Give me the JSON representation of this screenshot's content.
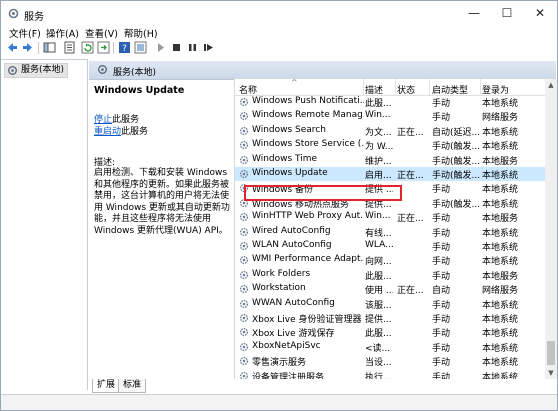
{
  "window": {
    "title": "服务",
    "minimize": "—",
    "maximize": "☐",
    "close": "✕"
  },
  "menu": [
    "文件(F)",
    "操作(A)",
    "查看(V)",
    "帮助(H)"
  ],
  "toolbar_icons": [
    "back-icon",
    "forward-icon",
    "show-tree-icon",
    "properties-icon",
    "refresh-icon",
    "export-icon",
    "help-icon",
    "mmc-icon",
    "start-icon",
    "stop-icon",
    "pause-icon",
    "restart-icon"
  ],
  "tree": {
    "node": "服务(本地)"
  },
  "panel": {
    "title": "服务(本地)"
  },
  "details": {
    "service_title": "Windows Update",
    "stop_link": "停止",
    "stop_suffix": "此服务",
    "restart_link": "重启动",
    "restart_suffix": "此服务",
    "desc_label": "描述:",
    "desc_text": "启用检测、下载和安装 Windows 和其他程序的更新。如果此服务被禁用，这台计算机的用户将无法使用 Windows 更新或其自动更新功能，并且这些程序将无法使用 Windows 更新代理(WUA) API。"
  },
  "columns": {
    "name": "名称",
    "desc": "描述",
    "status": "状态",
    "startup": "启动类型",
    "logon": "登录为"
  },
  "rows": [
    {
      "name": "Windows Push Notificati...",
      "desc": "此服...",
      "status": "",
      "startup": "手动",
      "logon": "本地系统"
    },
    {
      "name": "Windows Remote Manag...",
      "desc": "Win...",
      "status": "",
      "startup": "手动",
      "logon": "网络服务"
    },
    {
      "name": "Windows Search",
      "desc": "为文...",
      "status": "正在...",
      "startup": "自动(延迟...",
      "logon": "本地系统"
    },
    {
      "name": "Windows Store Service (...",
      "desc": "为 W...",
      "status": "",
      "startup": "手动(触发...",
      "logon": "本地系统"
    },
    {
      "name": "Windows Time",
      "desc": "维护...",
      "status": "",
      "startup": "手动(触发...",
      "logon": "本地服务"
    },
    {
      "name": "Windows Update",
      "desc": "启用...",
      "status": "正在...",
      "startup": "手动(触发...",
      "logon": "本地系统"
    },
    {
      "name": "Windows 备份",
      "desc": "提供 ...",
      "status": "",
      "startup": "手动",
      "logon": "本地系统"
    },
    {
      "name": "Windows 移动热点服务",
      "desc": "提供...",
      "status": "",
      "startup": "手动(触发...",
      "logon": "本地系统"
    },
    {
      "name": "WinHTTP Web Proxy Aut...",
      "desc": "Win...",
      "status": "正在...",
      "startup": "手动",
      "logon": "本地服务"
    },
    {
      "name": "Wired AutoConfig",
      "desc": "有线...",
      "status": "",
      "startup": "手动",
      "logon": "本地系统"
    },
    {
      "name": "WLAN AutoConfig",
      "desc": "WLA...",
      "status": "",
      "startup": "手动",
      "logon": "本地系统"
    },
    {
      "name": "WMI Performance Adapt...",
      "desc": "向网...",
      "status": "",
      "startup": "手动",
      "logon": "本地系统"
    },
    {
      "name": "Work Folders",
      "desc": "此服...",
      "status": "",
      "startup": "手动",
      "logon": "本地服务"
    },
    {
      "name": "Workstation",
      "desc": "使用 ...",
      "status": "正在...",
      "startup": "自动",
      "logon": "网络服务"
    },
    {
      "name": "WWAN AutoConfig",
      "desc": "该服...",
      "status": "",
      "startup": "手动",
      "logon": "本地系统"
    },
    {
      "name": "Xbox Live 身份验证管理器",
      "desc": "提供...",
      "status": "",
      "startup": "手动",
      "logon": "本地系统"
    },
    {
      "name": "Xbox Live 游戏保存",
      "desc": "此服...",
      "status": "",
      "startup": "手动",
      "logon": "本地系统"
    },
    {
      "name": "XboxNetApiSvc",
      "desc": "<读...",
      "status": "",
      "startup": "手动",
      "logon": "本地系统"
    },
    {
      "name": "零售演示服务",
      "desc": "当设...",
      "status": "",
      "startup": "手动",
      "logon": "本地系统"
    },
    {
      "name": "设备管理注册服务",
      "desc": "执行...",
      "status": "",
      "startup": "手动",
      "logon": "本地系统"
    }
  ],
  "selected_row": 5,
  "tabs": [
    "扩展",
    "标准"
  ],
  "colors": {
    "selection": "#cce8ff",
    "highlight_border": "#e0252b",
    "link": "#0a58c8"
  }
}
